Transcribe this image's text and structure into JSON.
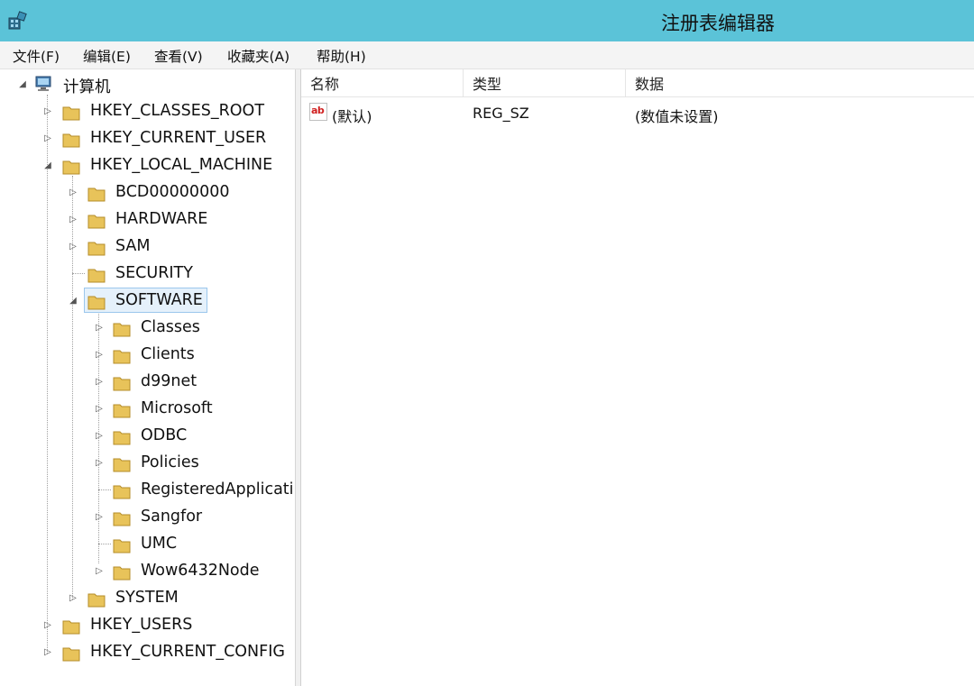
{
  "window": {
    "title": "注册表编辑器"
  },
  "menu": [
    {
      "label": "文件(F)"
    },
    {
      "label": "编辑(E)"
    },
    {
      "label": "查看(V)"
    },
    {
      "label": "收藏夹(A)"
    },
    {
      "label": "帮助(H)"
    }
  ],
  "tree": {
    "root": {
      "label": "计算机",
      "icon": "computer-icon"
    },
    "hives": [
      {
        "label": "HKEY_CLASSES_ROOT",
        "expanded": false
      },
      {
        "label": "HKEY_CURRENT_USER",
        "expanded": false
      },
      {
        "label": "HKEY_LOCAL_MACHINE",
        "expanded": true
      },
      {
        "label": "HKEY_USERS",
        "expanded": false
      },
      {
        "label": "HKEY_CURRENT_CONFIG",
        "expanded": false
      }
    ],
    "hklm_children": [
      {
        "label": "BCD00000000",
        "has_children": true
      },
      {
        "label": "HARDWARE",
        "has_children": true
      },
      {
        "label": "SAM",
        "has_children": true
      },
      {
        "label": "SECURITY",
        "has_children": false
      },
      {
        "label": "SOFTWARE",
        "has_children": true,
        "selected": true,
        "expanded": true
      },
      {
        "label": "SYSTEM",
        "has_children": true
      }
    ],
    "software_children": [
      {
        "label": "Classes",
        "has_children": true
      },
      {
        "label": "Clients",
        "has_children": true
      },
      {
        "label": "d99net",
        "has_children": true
      },
      {
        "label": "Microsoft",
        "has_children": true
      },
      {
        "label": "ODBC",
        "has_children": true
      },
      {
        "label": "Policies",
        "has_children": true
      },
      {
        "label": "RegisteredApplicati",
        "has_children": false
      },
      {
        "label": "Sangfor",
        "has_children": true
      },
      {
        "label": "UMC",
        "has_children": false
      },
      {
        "label": "Wow6432Node",
        "has_children": true
      }
    ]
  },
  "list": {
    "columns": [
      "名称",
      "类型",
      "数据"
    ],
    "rows": [
      {
        "name": "(默认)",
        "type": "REG_SZ",
        "data": "(数值未设置)",
        "icon": "reg-sz-icon"
      }
    ]
  },
  "colors": {
    "titlebar": "#5bc3d8",
    "folder": "#e8c35a",
    "selection": "#e5f1fb"
  }
}
